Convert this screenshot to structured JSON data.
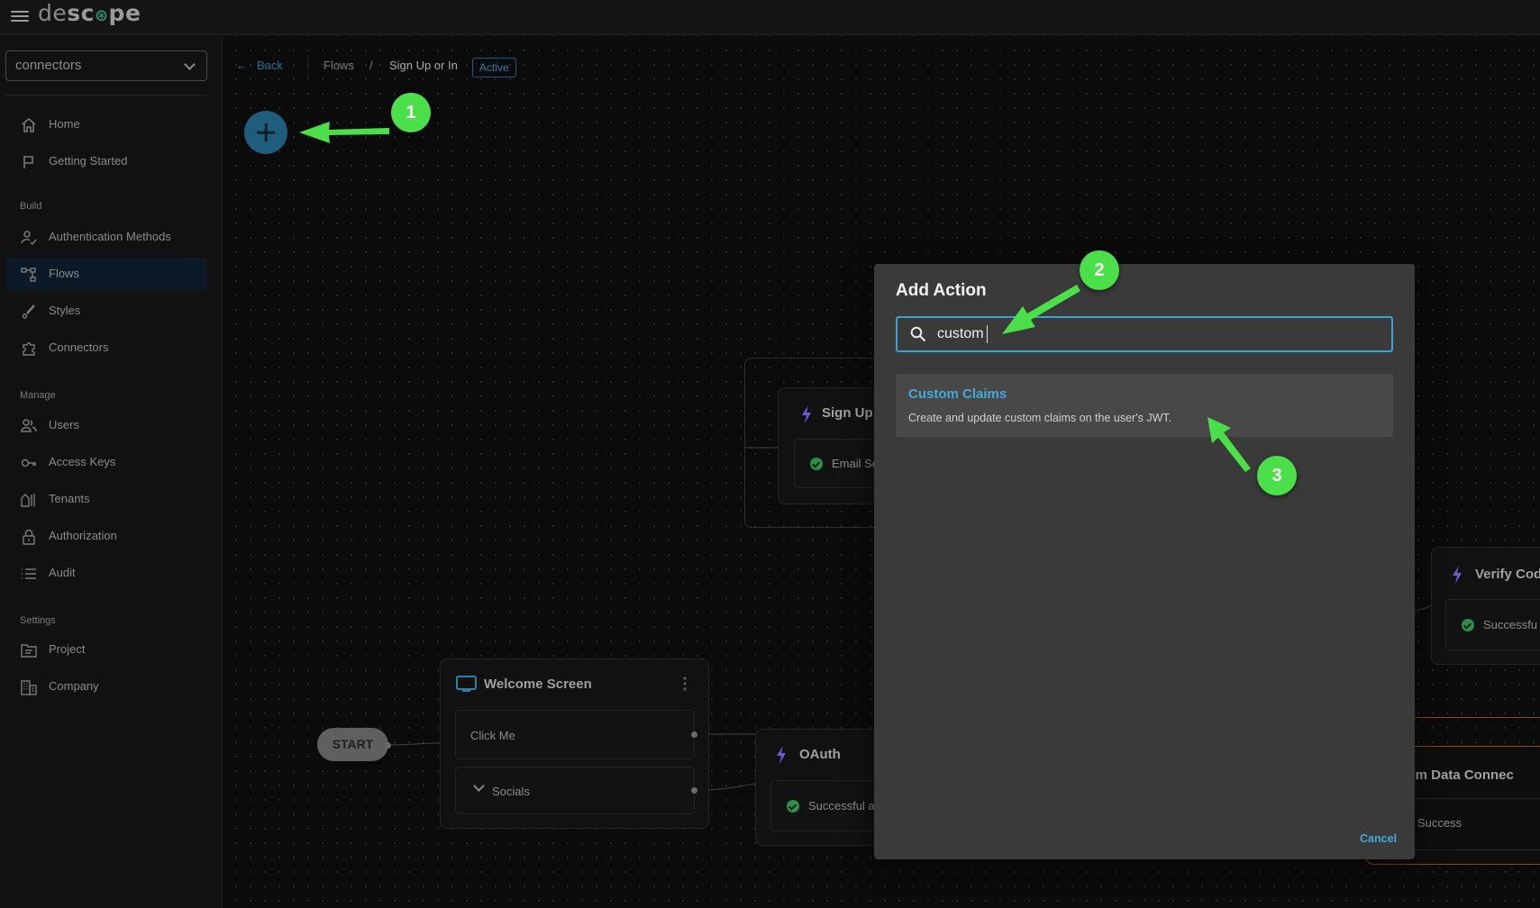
{
  "app": {
    "logo_parts": [
      "de",
      "sc",
      "⊛",
      "pe"
    ]
  },
  "sidebar": {
    "project_selector": "connectors",
    "items": [
      {
        "label": "Home",
        "icon": "home-icon"
      },
      {
        "label": "Getting Started",
        "icon": "flag-icon"
      },
      {
        "label": "Authentication Methods",
        "icon": "user-check-icon"
      },
      {
        "label": "Flows",
        "icon": "flow-icon",
        "active": true
      },
      {
        "label": "Styles",
        "icon": "brush-icon"
      },
      {
        "label": "Connectors",
        "icon": "puzzle-icon"
      },
      {
        "label": "Users",
        "icon": "users-icon"
      },
      {
        "label": "Access Keys",
        "icon": "key-icon"
      },
      {
        "label": "Tenants",
        "icon": "building-icon"
      },
      {
        "label": "Authorization",
        "icon": "lock-icon"
      },
      {
        "label": "Audit",
        "icon": "list-icon"
      },
      {
        "label": "Project",
        "icon": "folder-icon"
      },
      {
        "label": "Company",
        "icon": "company-icon"
      }
    ],
    "sections": {
      "build": "Build",
      "manage": "Manage",
      "settings": "Settings"
    }
  },
  "breadcrumb": {
    "back_label": "Back",
    "back_arrow": "←",
    "flows": "Flows",
    "separator": "/",
    "current": "Sign Up or In",
    "status": "Active"
  },
  "canvas": {
    "start_label": "START",
    "nodes": {
      "welcome": {
        "title": "Welcome Screen",
        "rows": [
          "Click Me",
          "Socials"
        ]
      },
      "signup": {
        "title": "Sign Up",
        "row": "Email Se"
      },
      "oauth": {
        "title": "OAuth",
        "row": "Successful a"
      },
      "verify": {
        "title": "Verify Cod",
        "row": "Successfu"
      },
      "random": {
        "title": "Random Data Connec",
        "row": "Success"
      }
    }
  },
  "modal": {
    "title": "Add Action",
    "search_value": "custom",
    "results": [
      {
        "title": "Custom Claims",
        "description": "Create and update custom claims on the user's JWT."
      }
    ],
    "cancel_label": "Cancel"
  },
  "annotations": {
    "badges": [
      "1",
      "2",
      "3"
    ],
    "color": "#4be04a"
  },
  "colors": {
    "accent": "#3aa3d4",
    "active_nav_bg": "#0c1a27",
    "success": "#2f8e4c",
    "action_bolt": "#6b5bd6",
    "connector_border": "#b8661a"
  }
}
